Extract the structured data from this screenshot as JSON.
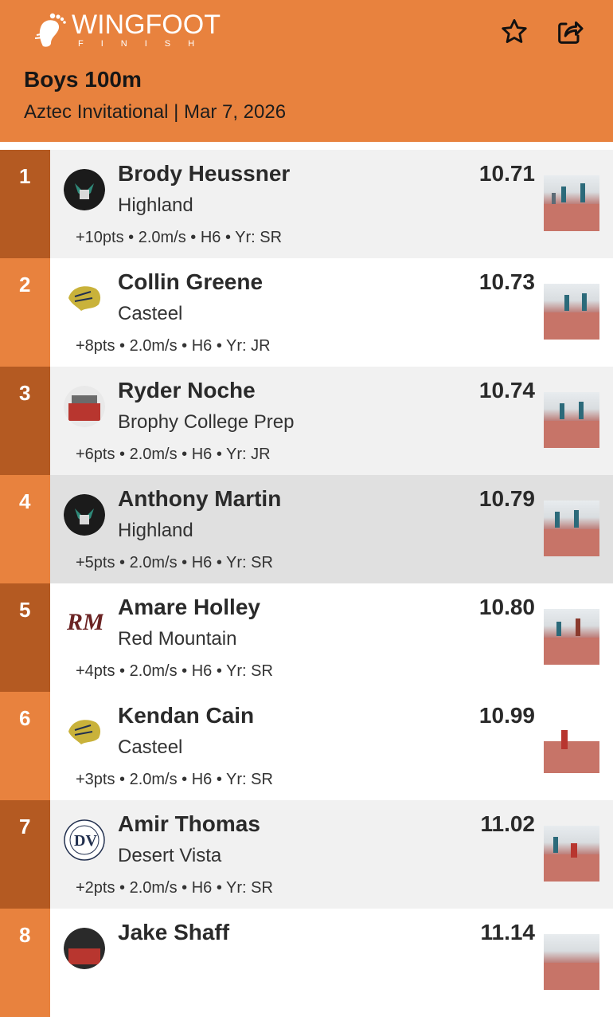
{
  "app": {
    "logo_word": "WINGFOOT",
    "logo_sub": "FINISH",
    "star_icon": "star-outline-icon",
    "share_icon": "share-icon"
  },
  "event": {
    "title": "Boys 100m",
    "subtitle": "Aztec Invitational | Mar 7, 2026"
  },
  "colors": {
    "header": "#e8823e",
    "place_dark": "#b45a22",
    "place_light": "#e8823e"
  },
  "results": [
    {
      "place": "1",
      "name": "Brody Heussner",
      "school": "Highland",
      "mark": "10.71",
      "meta": "+10pts • 2.0m/s • H6 • Yr: SR",
      "school_logo": "highland-logo"
    },
    {
      "place": "2",
      "name": "Collin Greene",
      "school": "Casteel",
      "mark": "10.73",
      "meta": "+8pts • 2.0m/s • H6 • Yr: JR",
      "school_logo": "casteel-logo"
    },
    {
      "place": "3",
      "name": "Ryder Noche",
      "school": "Brophy College Prep",
      "mark": "10.74",
      "meta": "+6pts • 2.0m/s • H6 • Yr: JR",
      "school_logo": "brophy-logo"
    },
    {
      "place": "4",
      "name": "Anthony Martin",
      "school": "Highland",
      "mark": "10.79",
      "meta": "+5pts • 2.0m/s • H6 • Yr: SR",
      "school_logo": "highland-logo"
    },
    {
      "place": "5",
      "name": "Amare Holley",
      "school": "Red Mountain",
      "mark": "10.80",
      "meta": "+4pts • 2.0m/s • H6 • Yr: SR",
      "school_logo": "red-mountain-logo"
    },
    {
      "place": "6",
      "name": "Kendan Cain",
      "school": "Casteel",
      "mark": "10.99",
      "meta": "+3pts • 2.0m/s • H6 • Yr: SR",
      "school_logo": "casteel-logo"
    },
    {
      "place": "7",
      "name": "Amir Thomas",
      "school": "Desert Vista",
      "mark": "11.02",
      "meta": "+2pts • 2.0m/s • H6 • Yr: SR",
      "school_logo": "desert-vista-logo"
    },
    {
      "place": "8",
      "name": "Jake Shaff",
      "school": "",
      "mark": "11.14",
      "meta": "",
      "school_logo": "brophy-logo"
    }
  ]
}
